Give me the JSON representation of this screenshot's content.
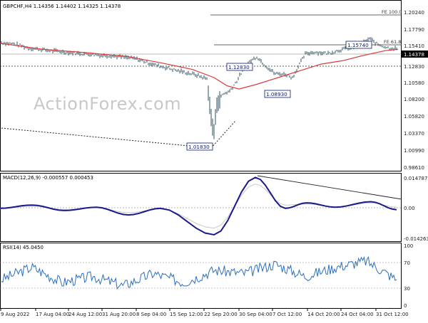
{
  "panes": {
    "main_title": "GBPCHF,H4  1.14356 1.14402 1.14325 1.14378",
    "macd_title": "MACD(12,26,9) -0.000557 0.000453",
    "rsi_title": "RSI(14) 45.0450",
    "watermark": "ActionForex.com"
  },
  "chart_data": [
    {
      "type": "line",
      "title": "GBPCHF,H4  1.14356 1.14402 1.14325 1.14378",
      "x": [
        "9 Aug 2022",
        "17 Aug 04:00",
        "24 Aug 12:00",
        "31 Aug 20:00",
        "8 Sep 04:00",
        "15 Sep 12:00",
        "22 Sep 20:00",
        "30 Sep 04:00",
        "7 Oct 12:00",
        "14 Oct 20:00",
        "24 Oct 04:00",
        "31 Oct 12:00"
      ],
      "series": [
        {
          "values": [
            1.15,
            1.145,
            1.136,
            1.134,
            1.13,
            1.122,
            1.103,
            1.02,
            1.085,
            1.108,
            1.13,
            1.148
          ]
        },
        {
          "values": [
            1.151,
            1.146,
            1.14,
            1.136,
            1.131,
            1.124,
            1.11,
            1.08,
            1.1,
            1.115,
            1.13,
            1.141
          ]
        }
      ],
      "ylim": [
        0.9617,
        1.2046
      ],
      "y_ticks": [
        "1.20240",
        "1.17790",
        "1.15410",
        "1.14378",
        "1.12830",
        "1.10580",
        "1.08200",
        "1.05820",
        "1.03370",
        "1.00990",
        "0.98610"
      ],
      "last_price": "1.14378",
      "levels": [
        {
          "label": "FE 100.0",
          "value": 1.2024
        },
        {
          "label": "FE 61.8",
          "value": 1.1541
        }
      ],
      "annotations": [
        "1.15740",
        "1.12830",
        "1.08930",
        "1.01830"
      ],
      "grid": false
    },
    {
      "type": "line",
      "title": "MACD(12,26,9) -0.000557 0.000453",
      "ylim": [
        -0.014263,
        0.014787
      ],
      "y_ticks": [
        "0.014787",
        "0.00",
        "-0.014263"
      ],
      "series": [
        {
          "values": [
            0.0,
            0.0015,
            -0.001,
            0.0005,
            -0.003,
            0.0,
            -0.012,
            0.014,
            0.0,
            0.0025,
            0.0005,
            0.003,
            -0.0006
          ]
        },
        {
          "values": [
            -0.0002,
            0.001,
            -0.0005,
            0.0003,
            -0.002,
            -0.0003,
            -0.009,
            0.011,
            0.0015,
            0.002,
            0.0005,
            0.0025,
            0.0005
          ]
        }
      ]
    },
    {
      "type": "line",
      "title": "RSI(14) 45.0450",
      "ylim": [
        0,
        100
      ],
      "y_ticks": [
        "100",
        "70",
        "30",
        "0"
      ],
      "series": [
        {
          "values": [
            45,
            65,
            40,
            50,
            35,
            55,
            40,
            60,
            55,
            70,
            50,
            65,
            75,
            45
          ]
        }
      ]
    }
  ]
}
